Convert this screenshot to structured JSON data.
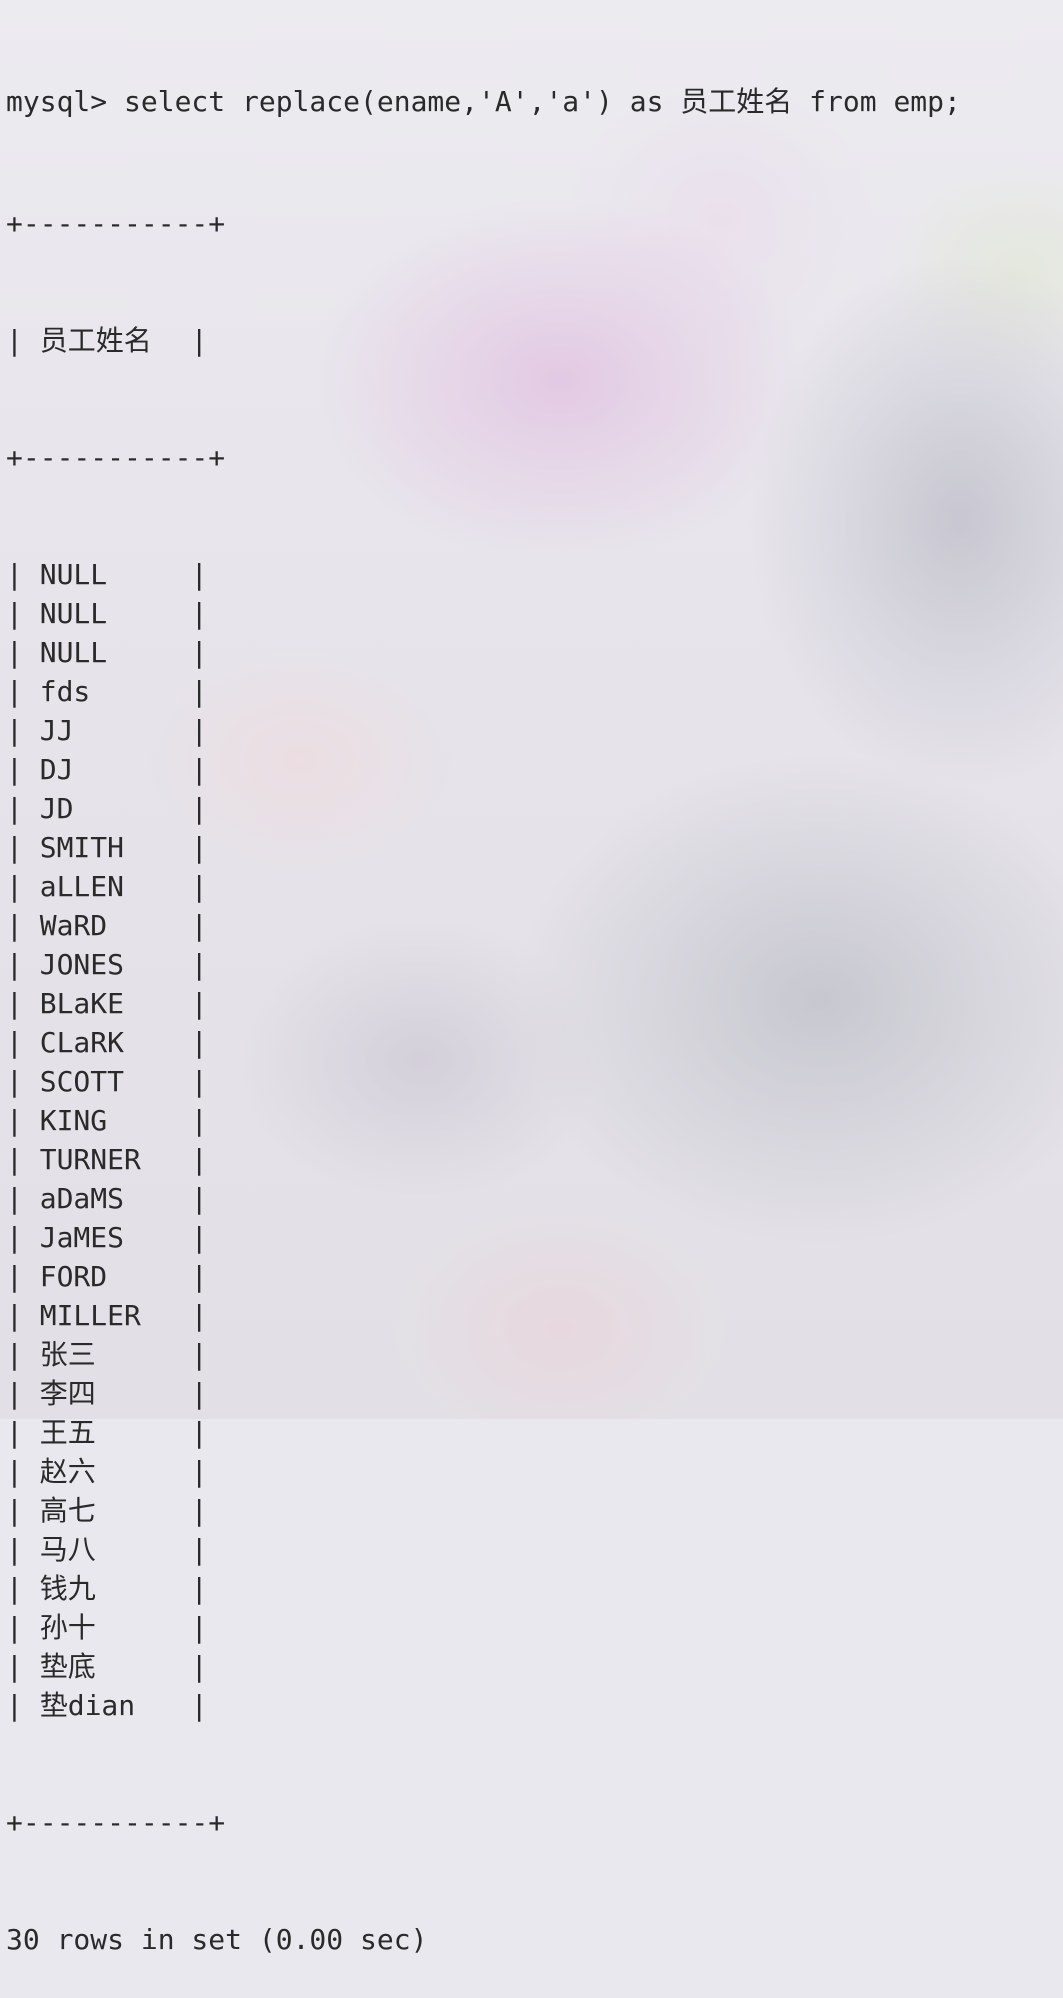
{
  "terminal": {
    "command_line": "mysql> select replace(ename,'A','a') as 员工姓名 from emp;",
    "table_border": "+-----------+",
    "column_header": "员工姓名",
    "rows": [
      "NULL",
      "NULL",
      "NULL",
      "fds",
      "JJ",
      "DJ",
      "JD",
      "SMITH",
      "aLLEN",
      "WaRD",
      "JONES",
      "BLaKE",
      "CLaRK",
      "SCOTT",
      "KING",
      "TURNER",
      "aDaMS",
      "JaMES",
      "FORD",
      "MILLER",
      "张三",
      "李四",
      "王五",
      "赵六",
      "高七",
      "马八",
      "钱九",
      "孙十",
      "垫底",
      "垫dian"
    ],
    "summary": "30 rows in set (0.00 sec)"
  }
}
